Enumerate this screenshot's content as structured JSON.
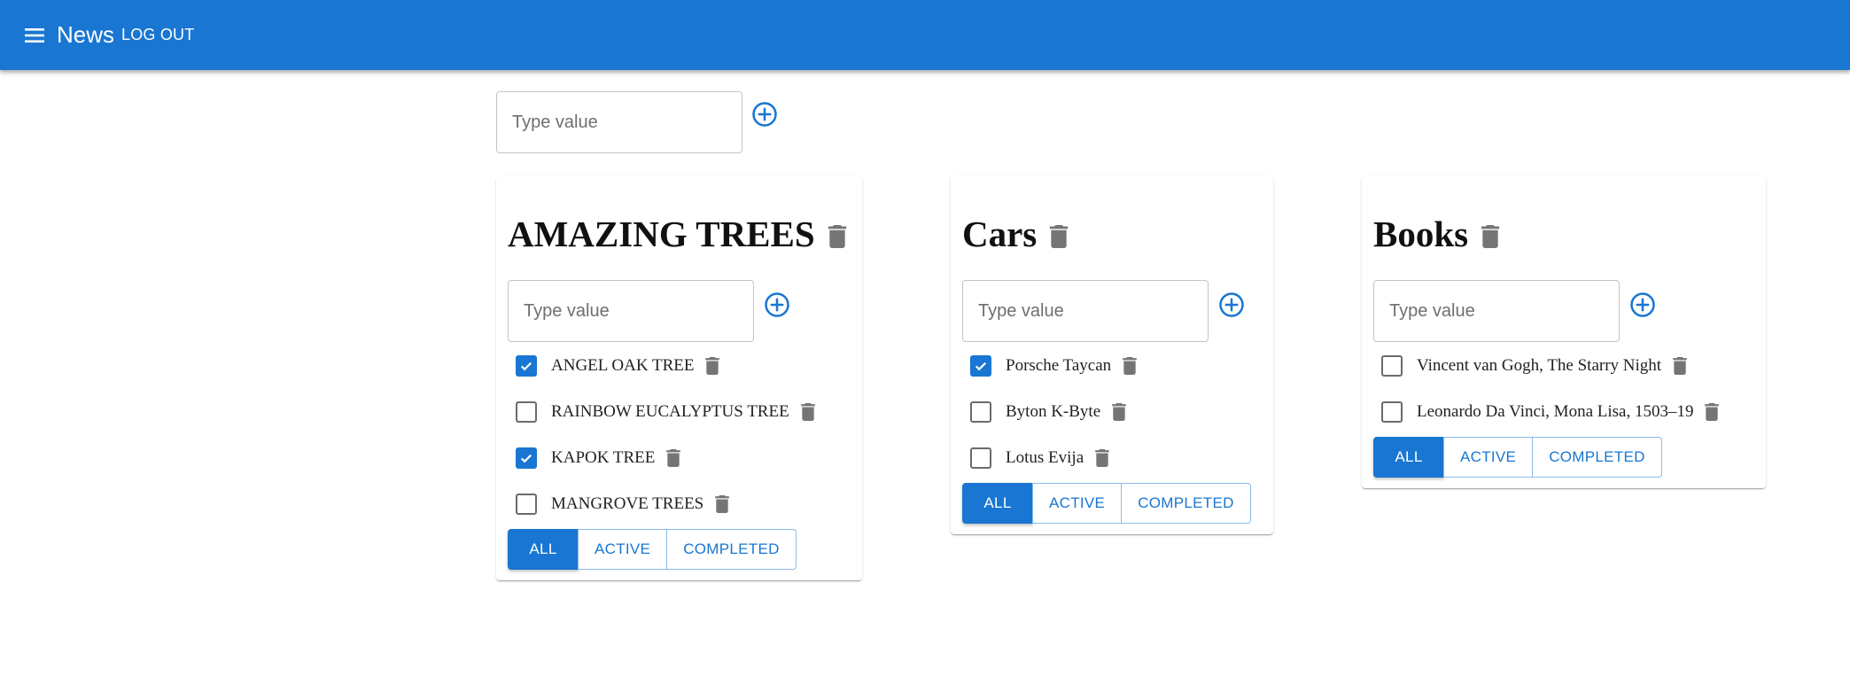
{
  "appbar": {
    "title": "News",
    "logout_label": "LOG OUT",
    "color": "#1976d2"
  },
  "new_list": {
    "placeholder": "Type value"
  },
  "filters": [
    "ALL",
    "ACTIVE",
    "COMPLETED"
  ],
  "lists": [
    {
      "title": "AMAZING TREES",
      "placeholder": "Type value",
      "tasks": [
        {
          "label": "ANGEL OAK TREE",
          "done": true
        },
        {
          "label": "RAINBOW EUCALYPTUS TREE",
          "done": false
        },
        {
          "label": "KAPOK TREE",
          "done": true
        },
        {
          "label": "MANGROVE TREES",
          "done": false
        }
      ],
      "active_filter": "ALL"
    },
    {
      "title": "Cars",
      "placeholder": "Type value",
      "tasks": [
        {
          "label": "Porsche Taycan",
          "done": true
        },
        {
          "label": "Byton K-Byte",
          "done": false
        },
        {
          "label": "Lotus Evija",
          "done": false
        }
      ],
      "active_filter": "ALL"
    },
    {
      "title": "Books",
      "placeholder": "Type value",
      "tasks": [
        {
          "label": "Vincent van Gogh, The Starry Night",
          "done": false
        },
        {
          "label": "Leonardo Da Vinci, Mona Lisa, 1503–19",
          "done": false
        }
      ],
      "active_filter": "ALL"
    }
  ]
}
